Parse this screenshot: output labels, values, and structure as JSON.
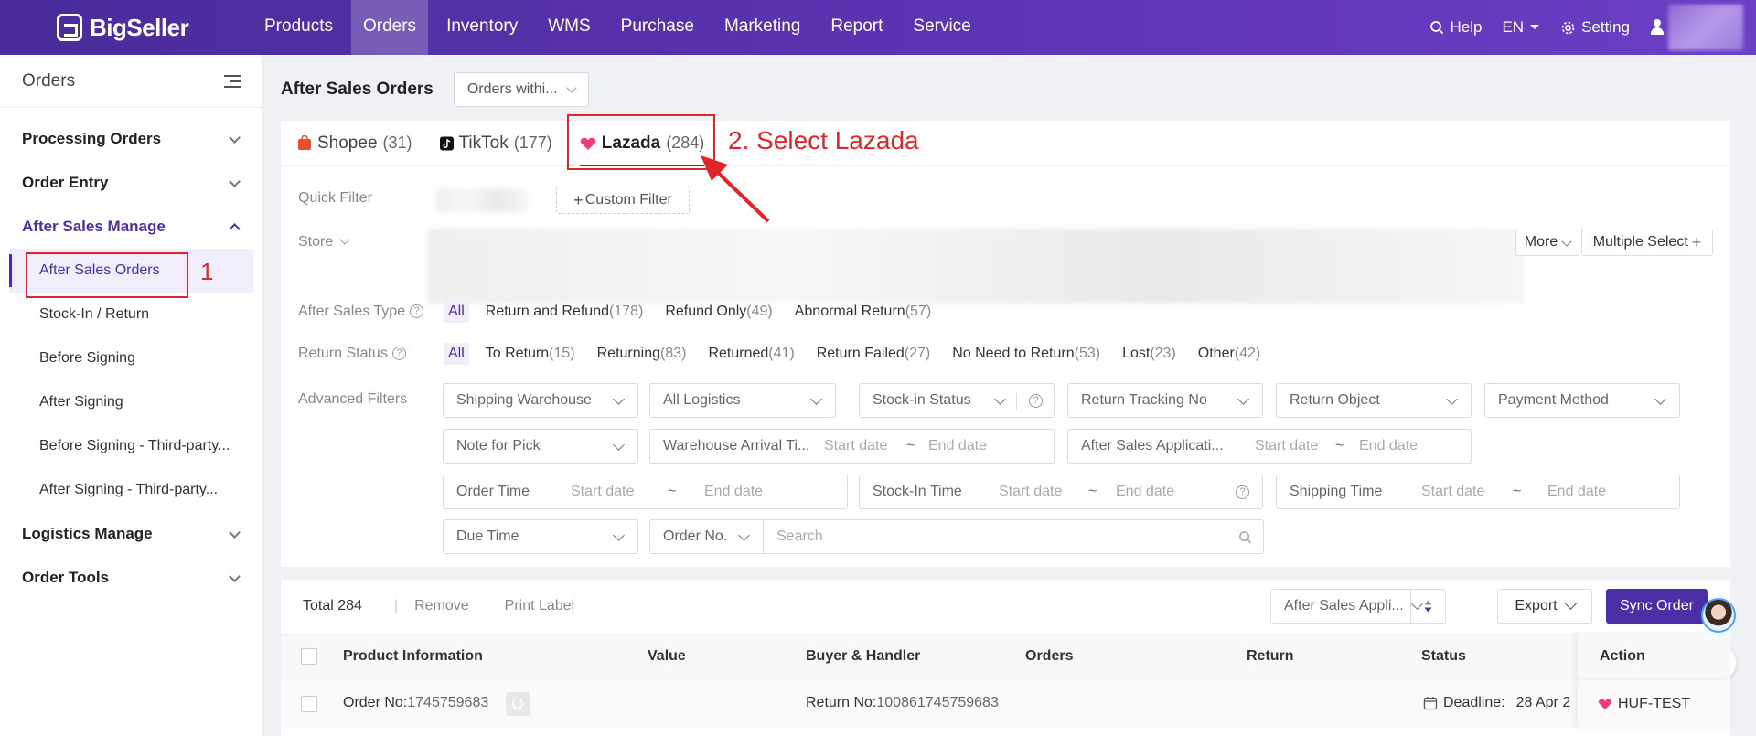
{
  "brand": {
    "name": "BigSeller"
  },
  "nav": [
    "Products",
    "Orders",
    "Inventory",
    "WMS",
    "Purchase",
    "Marketing",
    "Report",
    "Service"
  ],
  "top_right": {
    "help": "Help",
    "language": "EN",
    "setting": "Setting"
  },
  "sidebar": {
    "title": "Orders",
    "groups": {
      "processing": "Processing Orders",
      "entry": "Order Entry",
      "after_sales": "After Sales Manage",
      "logistics": "Logistics Manage",
      "tools": "Order Tools"
    },
    "after_sales_items": [
      "After Sales Orders",
      "Stock-In / Return",
      "Before Signing",
      "After Signing",
      "Before Signing - Third-party...",
      "After Signing - Third-party..."
    ]
  },
  "page": {
    "title": "After Sales Orders",
    "scope_select": "Orders withi..."
  },
  "tabs": [
    {
      "label": "Shopee",
      "count": "(31)"
    },
    {
      "label": "TikTok",
      "count": "(177)"
    },
    {
      "label": "Lazada",
      "count": "(284)"
    }
  ],
  "filters": {
    "quick_filter_label": "Quick Filter",
    "custom_filter": "Custom Filter",
    "store_label": "Store",
    "more": "More",
    "multiple_select": "Multiple Select",
    "after_sales_type_label": "After Sales Type",
    "after_sales_type": [
      {
        "label": "All",
        "n": ""
      },
      {
        "label": "Return and Refund",
        "n": "(178)"
      },
      {
        "label": "Refund Only",
        "n": "(49)"
      },
      {
        "label": "Abnormal Return",
        "n": "(57)"
      }
    ],
    "return_status_label": "Return Status",
    "return_status": [
      {
        "label": "All",
        "n": ""
      },
      {
        "label": "To Return",
        "n": "(15)"
      },
      {
        "label": "Returning",
        "n": "(83)"
      },
      {
        "label": "Returned",
        "n": "(41)"
      },
      {
        "label": "Return Failed",
        "n": "(27)"
      },
      {
        "label": "No Need to Return",
        "n": "(53)"
      },
      {
        "label": "Lost",
        "n": "(23)"
      },
      {
        "label": "Other",
        "n": "(42)"
      }
    ],
    "advanced_label": "Advanced Filters",
    "shipping_warehouse": "Shipping Warehouse",
    "all_logistics": "All Logistics",
    "stock_in_status": "Stock-in Status",
    "return_tracking_no": "Return Tracking No",
    "return_object": "Return Object",
    "payment_method": "Payment Method",
    "note_for_pick": "Note for Pick",
    "warehouse_arrival": "Warehouse Arrival Ti...",
    "after_sales_application": "After Sales Applicati...",
    "order_time": "Order Time",
    "stock_in_time": "Stock-In Time",
    "shipping_time": "Shipping Time",
    "due_time": "Due Time",
    "order_no": "Order No.",
    "search_placeholder": "Search",
    "start_date": "Start date",
    "end_date": "End date",
    "tilde": "~"
  },
  "list": {
    "total": "Total 284",
    "remove": "Remove",
    "print_label": "Print Label",
    "sort_select": "After Sales Appli...",
    "export": "Export",
    "sync_order": "Sync Order",
    "columns": [
      "Product Information",
      "Value",
      "Buyer & Handler",
      "Orders",
      "Return",
      "Status",
      "Action"
    ],
    "row": {
      "order_no_label": "Order No:",
      "order_no": "1745759683",
      "return_no_label": "Return No:",
      "return_no": "100861745759683",
      "deadline_label": "Deadline:",
      "deadline": "28 Apr 2",
      "store": "HUF-TEST"
    }
  },
  "annotations": {
    "step1": "1",
    "step2": "2. Select Lazada"
  },
  "colors": {
    "brand": "#4b2fa6",
    "annotation": "#e0262b"
  }
}
